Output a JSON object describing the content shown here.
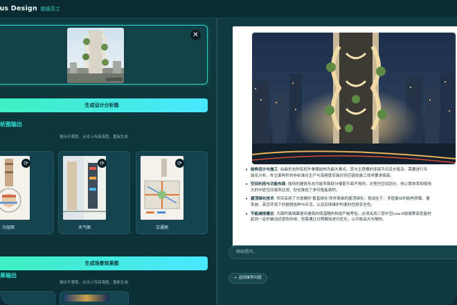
{
  "app": {
    "brand": "lus Design",
    "role": "超级员工"
  },
  "upload": {
    "close_icon": "close-icon"
  },
  "buttons": {
    "generate_analysis": "生成设计分析图",
    "generate_scene": "生成场景效果图"
  },
  "sections": {
    "analysis_title": "析图输出",
    "scene_title": "果输出",
    "hint": "输出不满意，点击上传高清图，重新生成"
  },
  "analysis_cards": [
    {
      "caption": "分层图",
      "icon": "refresh-icon"
    },
    {
      "caption": "天气图",
      "icon": "refresh-icon"
    },
    {
      "caption": "交通图",
      "icon": "refresh-icon"
    }
  ],
  "report": {
    "bullets": [
      {
        "key": "结构设计与施工",
        "lines": [
          ": 由曲形态的有机外骨骼结构为最大难点。其与主塔楼的连接节点设计复杂，需要进行专",
          "能化分析。外立面构件的非标准化生产与高精度安装对供应链和施工技术要求极高。"
        ]
      },
      {
        "key": "空间利用与功能布局",
        "lines": [
          ": 独特的建筑形态可能导致部分楼层平面不规则，对室内空间划分、核心筒效率和使用",
          "大的中庭空间虽然壮观，但也降低了净可租售面积。"
        ]
      },
      {
        "key": "屋顶绿化技术",
        "lines": [
          ": 项目采用了大规模的'垂直绿化'而非简单的屋顶绿化。挑战在于：多层露台的结构荷载、灌",
          "系统、高空环境下的植物选种与存活，以及后续维护的便利性和安全性。"
        ]
      },
      {
        "key": "节能减排建议",
        "lines": [
          ": 大面积玻璃幕墙对建筑的保温隔热构成严峻考验。必须采用三层中空Low-E玻璃等高性能材",
          "起到一定的被动式遮阳作用，但需通过日照模拟进行优化，以平衡采光与隔热。"
        ]
      }
    ]
  },
  "chat": {
    "placeholder": "继续提问...",
    "back_button": "返回推荐问题"
  },
  "colors": {
    "accent": "#2fe0cf",
    "button_gradient_start": "#3ef0c0",
    "button_gradient_end": "#49e6ff",
    "background": "#0e3139"
  }
}
